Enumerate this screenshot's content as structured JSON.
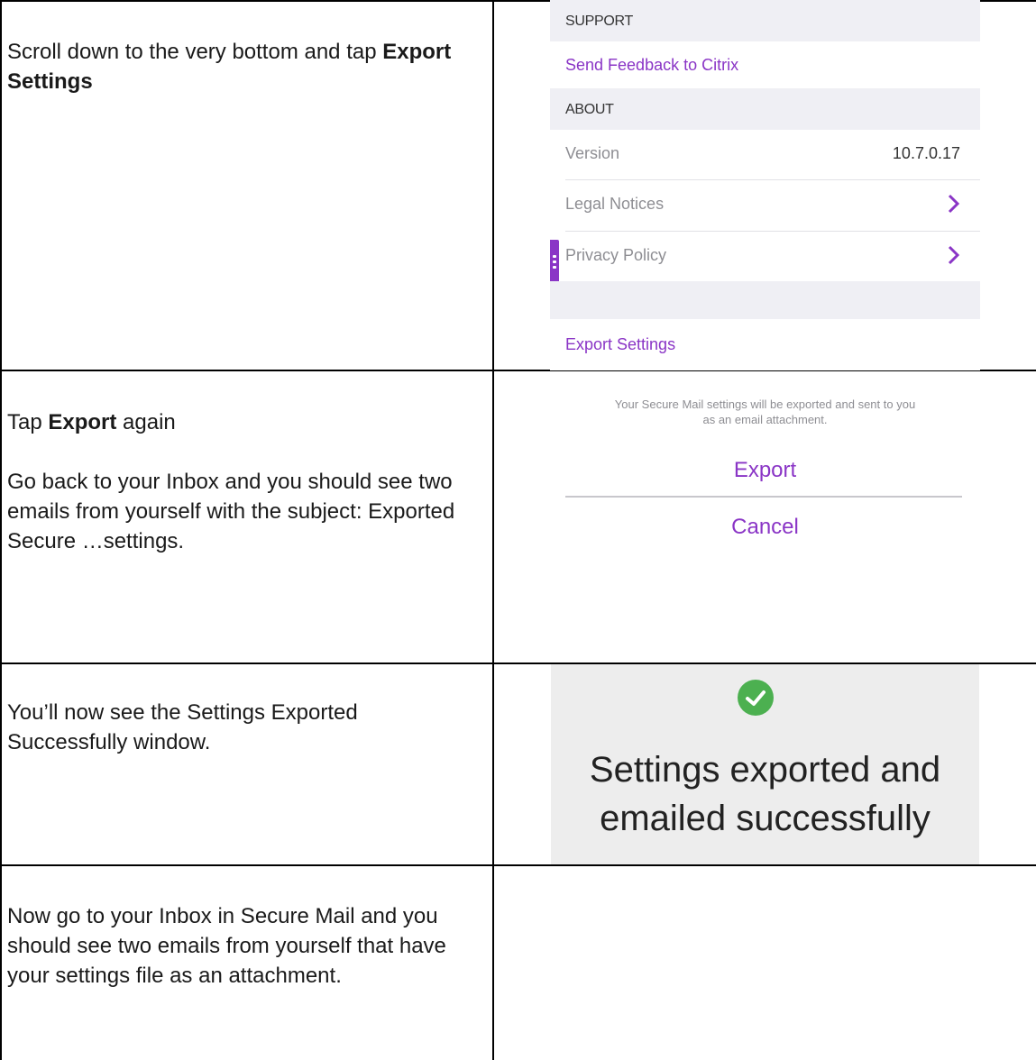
{
  "rows": [
    {
      "instruction_html": "Scroll down to the very bottom and tap <b>Export Settings</b>"
    },
    {
      "instruction_html": "Tap <b>Export</b> again",
      "note": "Go back to your Inbox and you should see two emails from yourself with the subject: Exported Secure …settings."
    },
    {
      "instruction": "You’ll now see the Settings Exported Successfully window."
    },
    {
      "instruction": "Now go to your Inbox in Secure Mail and you should see two emails from yourself that have your settings file as an attachment."
    }
  ],
  "settings_screen": {
    "support_header": "SUPPORT",
    "send_feedback": "Send Feedback to Citrix",
    "about_header": "ABOUT",
    "version_label": "Version",
    "version_value": "10.7.0.17",
    "legal_notices": "Legal Notices",
    "privacy_policy": "Privacy Policy",
    "export_settings": "Export Settings",
    "accent_color": "#8a35c6"
  },
  "export_dialog": {
    "message_line1": "Your Secure Mail settings will be exported and sent to you",
    "message_line2": "as an email attachment.",
    "export_button": "Export",
    "cancel_button": "Cancel"
  },
  "success_dialog": {
    "line1": "Settings exported and",
    "line2": "emailed successfully",
    "check_color": "#4cb050"
  }
}
